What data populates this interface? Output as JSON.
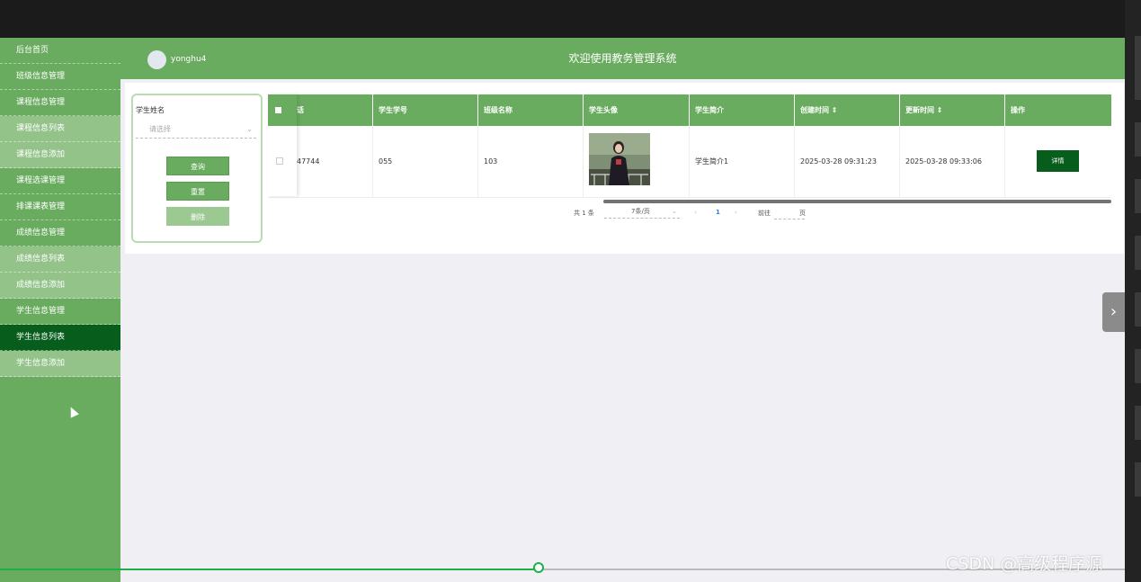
{
  "header": {
    "username": "yonghu4",
    "title": "欢迎使用教务管理系统"
  },
  "sidebar": {
    "items": [
      {
        "label": "后台首页"
      },
      {
        "label": "班级信息管理"
      },
      {
        "label": "课程信息管理"
      },
      {
        "label": "课程信息列表"
      },
      {
        "label": "课程信息添加"
      },
      {
        "label": "课程选课管理"
      },
      {
        "label": "排课课表管理"
      },
      {
        "label": "成绩信息管理"
      },
      {
        "label": "成绩信息列表"
      },
      {
        "label": "成绩信息添加"
      },
      {
        "label": "学生信息管理"
      },
      {
        "label": "学生信息列表"
      },
      {
        "label": "学生信息添加"
      }
    ]
  },
  "search": {
    "label": "学生姓名",
    "placeholder": "请选择",
    "query_button": "查询",
    "reset_button": "重置",
    "delete_button": "删除"
  },
  "table": {
    "headers": [
      "话",
      "学生学号",
      "班级名称",
      "学生头像",
      "学生简介",
      "创建时间 ⇕",
      "更新时间 ⇕",
      "操作"
    ],
    "rows": [
      {
        "phone": "47744",
        "student_no": "055",
        "class_name": "103",
        "intro": "学生简介1",
        "created": "2025-03-28 09:31:23",
        "updated": "2025-03-28 09:33:06",
        "action": "详情"
      }
    ]
  },
  "pagination": {
    "total": "共 1 条",
    "page_size": "7条/页",
    "current_page": "1",
    "goto_label": "前往",
    "page_suffix": "页"
  },
  "watermark": "CSDN @高级程序源",
  "colors": {
    "primary": "#6aac5f",
    "active": "#075d1b",
    "sub": "#94c38a"
  }
}
